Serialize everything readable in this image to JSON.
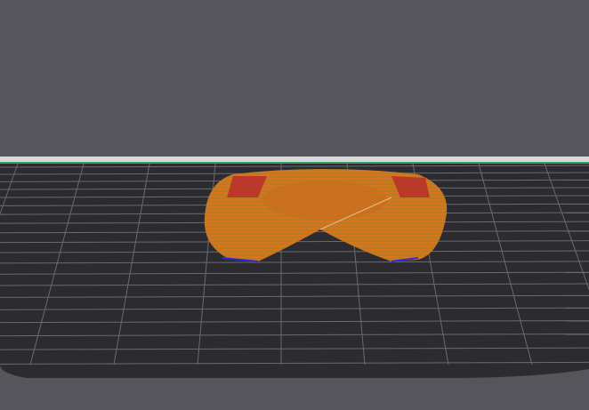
{
  "viewport": {
    "background": "#56555c",
    "bed_color": "#2b2b30",
    "grid_color": "#6a6a70",
    "bed_edge_color": "#d9d9d9",
    "bed_accent_color": "#3aa06a"
  },
  "model": {
    "primary_color": "#d9731c",
    "secondary_color": "#b8322a",
    "line_color": "#8a9a3a"
  }
}
